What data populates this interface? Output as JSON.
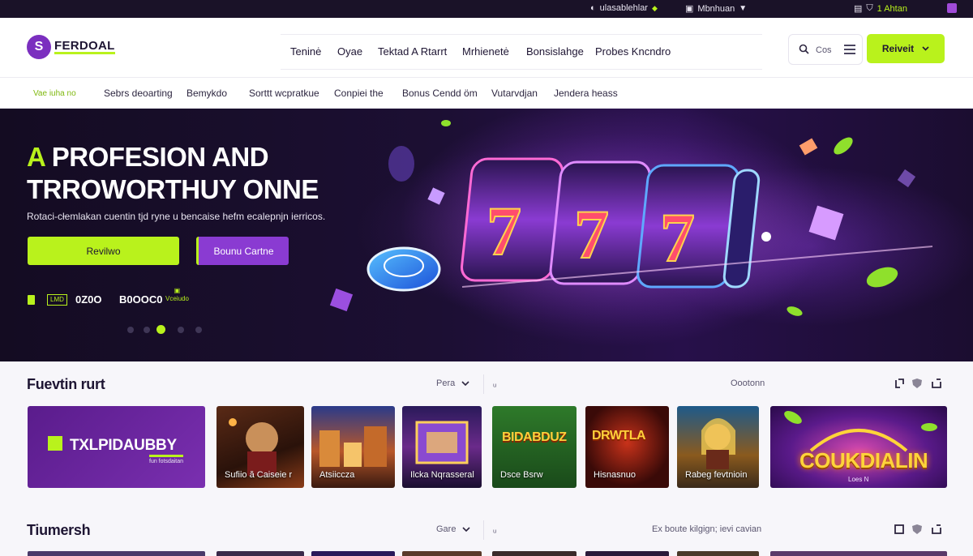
{
  "utility_bar": {
    "item1": "ulasablehlar",
    "item2": "Mbnhuan",
    "item3": "1 Ahtan"
  },
  "header": {
    "logo_text": "FERDOAL",
    "nav": [
      "Teninė",
      "Oyae",
      "Tektad A Rtarrt",
      "Mrhienetė",
      "Bonsislahge",
      "Probes Kncndro"
    ],
    "search_label": "Cos",
    "cta_label": "Reiveit"
  },
  "subnav": [
    "Vae iuha no",
    "Sebrs deoarting",
    "Bemykdo",
    "Sorttt wcpratkue",
    "Conpiei the",
    "Bonus Cendd öm",
    "Vutarvdjan",
    "Jendera heass"
  ],
  "hero": {
    "title_accent": "A",
    "title_line1": "PROFESION AND",
    "title_line2": "TRROWORTHUY ONNE",
    "subtitle": "Rotaci-cłemlakan cuentin tjd ryne u bencaise hefm ecalepnjn ierricos.",
    "btn_primary": "Revilwo",
    "btn_secondary": "Bounu Cartne",
    "stats": {
      "badge": "LMD",
      "value1": "0Z0O",
      "value2": "B0OOC0",
      "small": "Vceiudo"
    },
    "carousel": {
      "slides": 4,
      "active": 2
    }
  },
  "sections": [
    {
      "title": "Fuevtin rurt",
      "filter": "Pera",
      "sub": "ᵤ",
      "right": "Oootonn",
      "cards": [
        {
          "label": "TXLPIDAUBBY",
          "sublabel": "fun fotsdaitan"
        },
        {
          "label": "Sufiio ă Caiseie r"
        },
        {
          "label": "Atsiiccza"
        },
        {
          "label": "Ilcka Nqrasseral"
        },
        {
          "label": "Dsce Bsrw",
          "art": "BIDABDUZ"
        },
        {
          "label": "Hisnasnuo",
          "art": "DRWTLA"
        },
        {
          "label": "Rabeg fevtnioin"
        },
        {
          "label": "COUKDIALIN",
          "sublabel": "Loes N"
        }
      ]
    },
    {
      "title": "Tiumersh",
      "filter": "Gare",
      "sub": "ᵤ",
      "right": "Ex boute kilgign; ievi cavian"
    }
  ],
  "colors": {
    "accent": "#b9f21c",
    "brand": "#7b2fbf",
    "hero_bg": "#1c0f33",
    "page_bg": "#f7f6fa"
  }
}
